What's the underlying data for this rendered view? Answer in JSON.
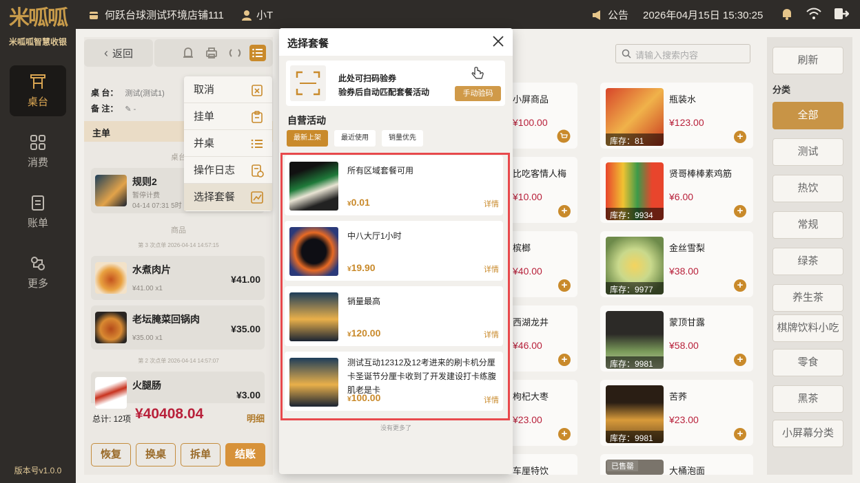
{
  "sidebar": {
    "brand": "米呱呱",
    "brand_sub": "米呱呱智慧收银",
    "items": [
      {
        "label": "桌台",
        "icon": "table-icon"
      },
      {
        "label": "消费",
        "icon": "grid-icon"
      },
      {
        "label": "账单",
        "icon": "bill-icon"
      },
      {
        "label": "更多",
        "icon": "more-icon"
      }
    ],
    "version": "版本号v1.0.0"
  },
  "topbar": {
    "store": "何跃台球测试环境店铺111",
    "user": "小T",
    "notice": "公告",
    "datetime": "2026年04月15日  15:30:25"
  },
  "order": {
    "back": "返回",
    "table_label": "桌 台：",
    "table_value": "测试(测试1)",
    "note_label": "备 注：",
    "note_value": "-",
    "main_label": "主单",
    "sep_table": "桌台",
    "sep_goods": "商品",
    "rule": {
      "name": "规则2",
      "sub1": "暂停计费",
      "sub2": "04-14 07:31 5时"
    },
    "batch3": "第 3 次点单 2026-04-14 14:57:15",
    "batch2": "第 2 次点单 2026-04-14 14:57:07",
    "items": [
      {
        "name": "水煮肉片",
        "sub": "¥41.00 x1",
        "price": "¥41.00"
      },
      {
        "name": "老坛腌菜回锅肉",
        "sub": "¥35.00 x1",
        "price": "¥35.00"
      },
      {
        "name": "火腿肠",
        "sub": "",
        "price": "¥3.00"
      }
    ],
    "total_label": "总计: 12项",
    "total_amount": "¥40408.04",
    "detail": "明细",
    "buttons": [
      "恢复",
      "换桌",
      "拆单",
      "结账"
    ]
  },
  "dropdown": {
    "items": [
      "取消",
      "挂单",
      "并桌",
      "操作日志",
      "选择套餐"
    ]
  },
  "products": {
    "search_placeholder": "请输入搜索内容",
    "left_col": [
      {
        "name": "小屏商品",
        "price": "¥100.00"
      },
      {
        "name": "比吃客情人梅",
        "price": "¥10.00"
      },
      {
        "name": "槟榔",
        "price": "¥40.00"
      },
      {
        "name": "西湖龙井",
        "price": "¥46.00"
      },
      {
        "name": "枸杞大枣",
        "price": "¥23.00"
      },
      {
        "name": "车厘特饮",
        "price": ""
      }
    ],
    "right_col": [
      {
        "name": "瓶装水",
        "price": "¥123.00",
        "stock": "库存：81"
      },
      {
        "name": "贤哥棒棒素鸡筋",
        "price": "¥6.00",
        "stock": "库存：9934"
      },
      {
        "name": "金丝雪梨",
        "price": "¥38.00",
        "stock": "库存：9977"
      },
      {
        "name": "蒙顶甘露",
        "price": "¥58.00",
        "stock": "库存：9981"
      },
      {
        "name": "苦荞",
        "price": "¥23.00",
        "stock": "库存：9981"
      },
      {
        "name": "大桶泡面",
        "price": "",
        "stock": "已售罄"
      }
    ]
  },
  "categories": {
    "refresh": "刷新",
    "label": "分类",
    "items": [
      "全部",
      "测试",
      "热饮",
      "常规",
      "绿茶",
      "养生茶",
      "棋牌饮料小吃",
      "零食",
      "黑茶",
      "小屏幕分类"
    ]
  },
  "modal": {
    "title": "选择套餐",
    "scan_line1": "此处可扫码验券",
    "scan_line2": "验券后自动匹配套餐活动",
    "manual": "手动验码",
    "section": "自营活动",
    "tabs": [
      "最新上架",
      "最近使用",
      "销量优先"
    ],
    "packages": [
      {
        "name": "所有区域套餐可用",
        "price": "0.01",
        "detail": "详情"
      },
      {
        "name": "中八大厅1小时",
        "price": "19.90",
        "detail": "详情"
      },
      {
        "name": "销量最高",
        "price": "120.00",
        "detail": "详情"
      },
      {
        "name": "测试互动12312及12考进来的刷卡机分厘卡圣诞节分厘卡收到了开发建设打卡练腹肌老是卡",
        "price": "100.00",
        "detail": "详情"
      }
    ],
    "currency": "¥",
    "no_more": "没有更多了"
  }
}
